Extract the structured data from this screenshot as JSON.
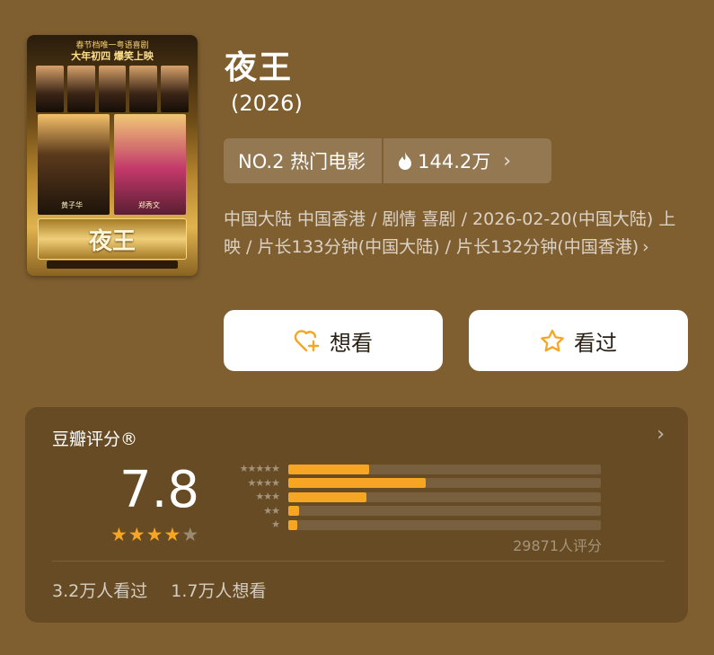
{
  "poster": {
    "top_line": "春节档唯一粤语喜剧",
    "top_highlight": "大年初四 爆笑上映",
    "lead_left": "黄子华",
    "lead_right": "郑秀文",
    "logo": "夜王"
  },
  "movie": {
    "title": "夜王",
    "year": "(2026)"
  },
  "rank": {
    "label": "NO.2 热门电影",
    "heat": "144.2万",
    "fire_icon": "fire-icon"
  },
  "info": {
    "text": "中国大陆 中国香港 / 剧情 喜剧 / 2026-02-20(中国大陆) 上映 / 片长133分钟(中国大陆) / 片长132分钟(中国香港)"
  },
  "actions": {
    "want_label": "想看",
    "seen_label": "看过",
    "want_icon": "heart-plus-icon",
    "seen_icon": "star-outline-icon"
  },
  "rating": {
    "label": "豆瓣评分®",
    "score": "7.8",
    "stars_filled": 4,
    "stars_total": 5,
    "distribution": [
      {
        "stars": 5,
        "fraction": 0.26
      },
      {
        "stars": 4,
        "fraction": 0.44
      },
      {
        "stars": 3,
        "fraction": 0.25
      },
      {
        "stars": 2,
        "fraction": 0.035
      },
      {
        "stars": 1,
        "fraction": 0.03
      }
    ],
    "count": "29871人评分",
    "seen_stat": "3.2万人看过",
    "want_stat": "1.7万人想看"
  },
  "colors": {
    "background": "#7f5f30",
    "accent": "#f6a623"
  }
}
